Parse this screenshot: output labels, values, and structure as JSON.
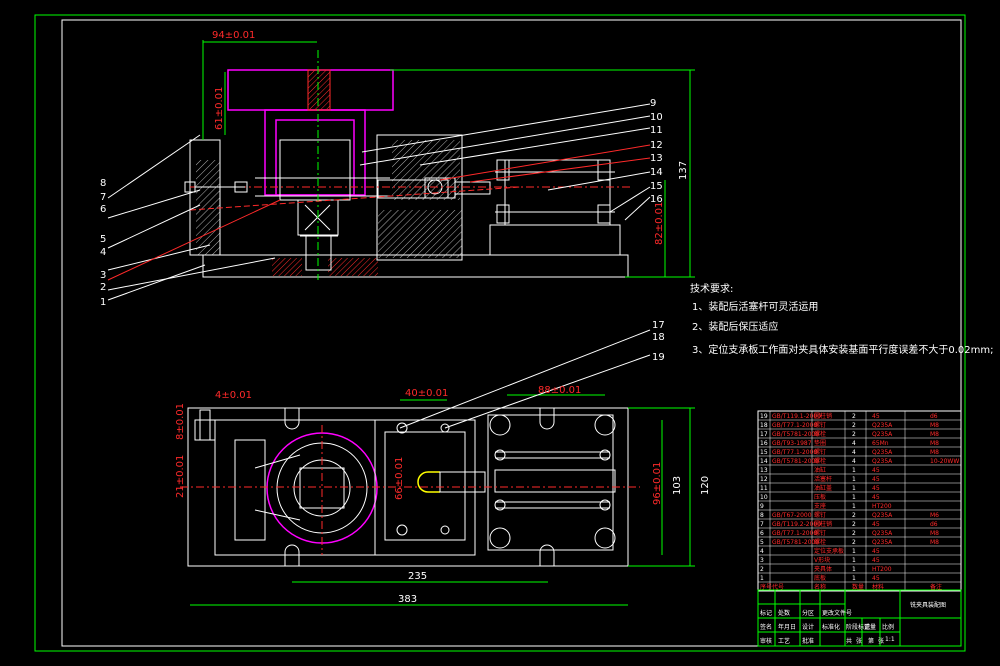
{
  "tech_requirements": {
    "title": "技术要求:",
    "items": [
      "1、装配后活塞杆可灵活运用",
      "2、装配后保压适应",
      "3、定位支承板工作面对夹具体安装基面平行度误差不大于0.02mm;"
    ]
  },
  "front_view": {
    "dimensions": [
      "94±0.01",
      "61±0.01",
      "137",
      "82±0.01"
    ],
    "balloons_left": [
      "8",
      "7",
      "6",
      "5",
      "4",
      "3",
      "2",
      "1"
    ],
    "balloons_right": [
      "9",
      "10",
      "11",
      "12",
      "13",
      "14",
      "15",
      "16"
    ]
  },
  "top_view": {
    "dimensions": [
      "4±0.01",
      "8±0.01",
      "21±0.01",
      "40±0.01",
      "88±0.01",
      "66±0.01",
      "96±0.01",
      "103",
      "120",
      "235",
      "383"
    ],
    "balloons": [
      "17",
      "18",
      "19"
    ]
  },
  "parts_list": {
    "rows": [
      [
        "19",
        "GB/T119.1-2000",
        "圆柱销",
        "2",
        "45",
        "d6"
      ],
      [
        "18",
        "GB/T77.1-2000",
        "螺钉",
        "2",
        "Q235A",
        "M8"
      ],
      [
        "17",
        "GB/T5781-2000",
        "螺栓",
        "2",
        "Q235A",
        "M8"
      ],
      [
        "16",
        "GB/T93-1987",
        "垫圈",
        "4",
        "65Mn",
        "M8"
      ],
      [
        "15",
        "GB/T77.1-2000",
        "螺钉",
        "4",
        "Q235A",
        "M8"
      ],
      [
        "14",
        "GB/T5781-2000",
        "螺栓",
        "4",
        "Q235A",
        "10-20WW"
      ],
      [
        "13",
        "",
        "油缸",
        "1",
        "45",
        ""
      ],
      [
        "12",
        "",
        "活塞杆",
        "1",
        "45",
        ""
      ],
      [
        "11",
        "",
        "油缸盖",
        "1",
        "45",
        ""
      ],
      [
        "10",
        "",
        "压板",
        "1",
        "45",
        ""
      ],
      [
        "9",
        "",
        "支座",
        "1",
        "HT200",
        ""
      ],
      [
        "8",
        "GB/T67-2000",
        "螺钉",
        "2",
        "Q235A",
        "M6"
      ],
      [
        "7",
        "GB/T119.2-2000",
        "圆柱销",
        "2",
        "45",
        "d6"
      ],
      [
        "6",
        "GB/T77.1-2000",
        "螺钉",
        "2",
        "Q235A",
        "M8"
      ],
      [
        "5",
        "GB/T5781-2000",
        "螺栓",
        "2",
        "Q235A",
        "M8"
      ],
      [
        "4",
        "",
        "定位支承板",
        "1",
        "45",
        ""
      ],
      [
        "3",
        "",
        "V形块",
        "1",
        "45",
        ""
      ],
      [
        "2",
        "",
        "夹具体",
        "1",
        "HT200",
        ""
      ],
      [
        "1",
        "",
        "底板",
        "1",
        "45",
        ""
      ]
    ],
    "header": [
      "序号",
      "代号",
      "名称",
      "数量",
      "材料",
      "备注"
    ]
  },
  "title_block": {
    "drawing_title": "铣夹具装配图",
    "labels": [
      "标记",
      "处数",
      "分区",
      "更改文件号",
      "签名",
      "年月日",
      "设计",
      "标准化",
      "审核",
      "工艺",
      "批准"
    ],
    "stage_labels": [
      "阶段标记",
      "重量",
      "比例"
    ],
    "scale": "1:1",
    "sheet_labels": [
      "共",
      "张",
      "第",
      "张"
    ]
  }
}
